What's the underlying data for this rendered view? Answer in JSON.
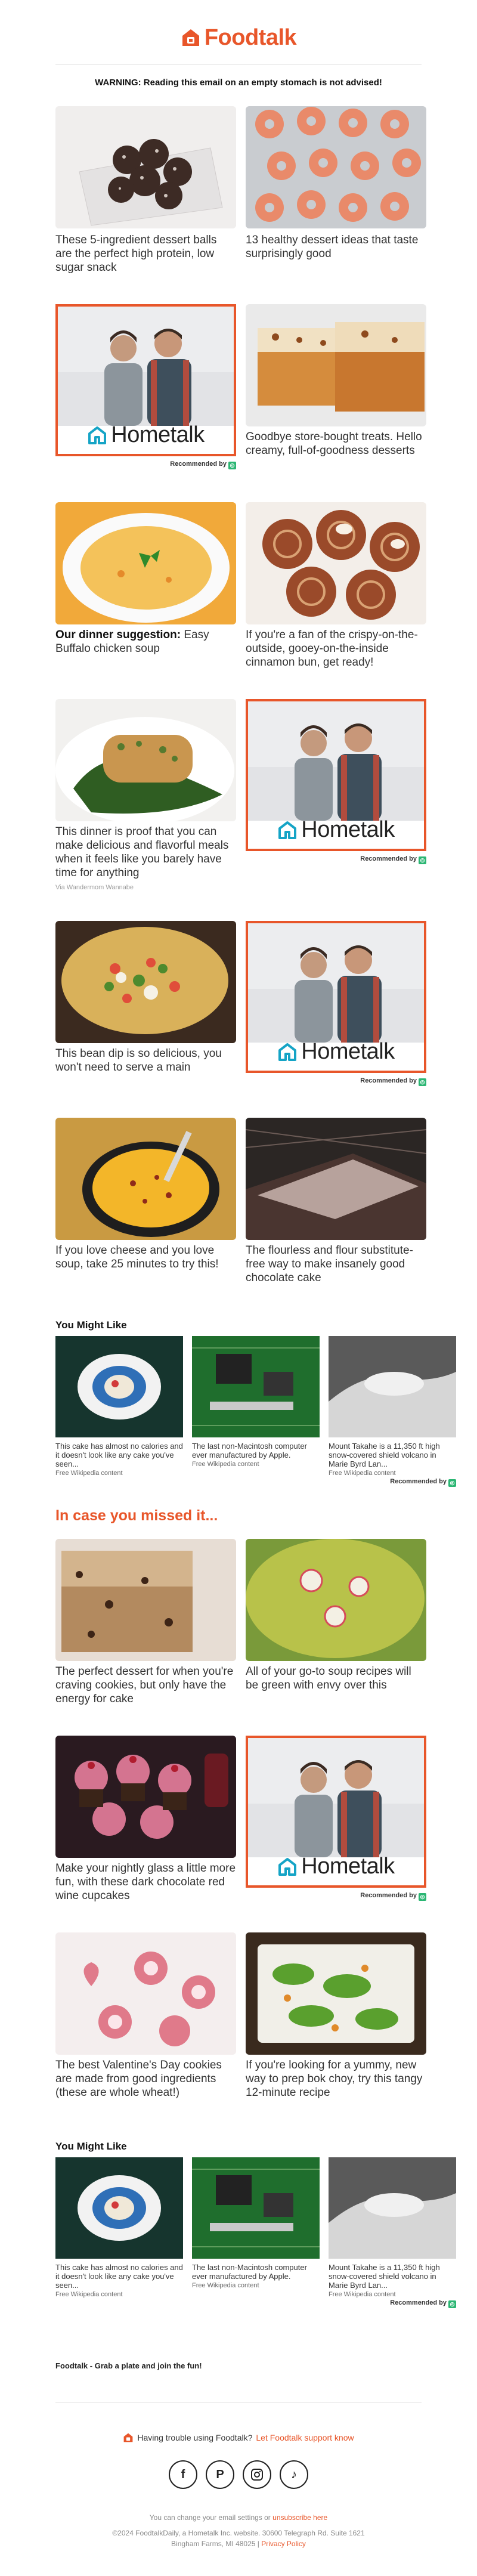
{
  "header": {
    "logo_text": "Foodtalk"
  },
  "warning": "WARNING: Reading this email on an empty stomach is not advised!",
  "articles": [
    {
      "caption": "These 5-ingredient dessert balls are the perfect high protein, low sugar snack"
    },
    {
      "caption": "13 healthy dessert ideas that taste surprisingly good"
    },
    {
      "caption": "Goodbye store-bought treats. Hello creamy, full-of-goodness desserts"
    },
    {
      "lead": "Our dinner suggestion:",
      "caption": "Easy Buffalo chicken soup"
    },
    {
      "caption": "If you're a fan of the crispy-on-the-outside, gooey-on-the-inside cinnamon bun, get ready!"
    },
    {
      "caption": "This dinner is proof that you can make delicious and flavorful meals when it feels like you barely have time for anything",
      "source": "Via Wandermom Wannabe"
    },
    {
      "caption": "This bean dip is so delicious, you won't need to serve a main"
    },
    {
      "caption": "If you love cheese and you love soup, take 25 minutes to try this!"
    },
    {
      "caption": "The flourless and flour substitute-free way to make insanely good chocolate cake"
    },
    {
      "caption": "The perfect dessert for when you're craving cookies, but only have the energy for cake"
    },
    {
      "caption": "All of your go-to soup recipes will be green with envy over this"
    },
    {
      "caption": "Make your nightly glass a little more fun, with these dark chocolate red wine cupcakes"
    },
    {
      "caption": "The best Valentine's Day cookies are made from good ingredients (these are whole wheat!)"
    },
    {
      "caption": "If you're looking for a yummy, new way to prep bok choy, try this tangy 12-minute recipe"
    }
  ],
  "ad": {
    "brand": "Hometalk",
    "recommended": "Recommended by"
  },
  "you_might_like": {
    "title": "You Might Like",
    "items": [
      {
        "caption": "This cake has almost no calories and it doesn't look like any cake you've seen...",
        "source": "Free Wikipedia content"
      },
      {
        "caption": "The last non-Macintosh computer ever manufactured by Apple.",
        "source": "Free Wikipedia content"
      },
      {
        "caption": "Mount Takahe is a 11,350 ft high snow-covered shield volcano in Marie Byrd Lan...",
        "source": "Free Wikipedia content"
      }
    ]
  },
  "missed_title": "In case you missed it...",
  "footer": {
    "tagline": "Foodtalk - Grab a plate and join the fun!",
    "trouble_text": "Having trouble using Foodtalk?",
    "trouble_link": "Let Foodtalk support know",
    "settings_text": "You can change your email settings or",
    "unsubscribe": "unsubscribe here",
    "address": "©2024 FoodtalkDaily, a Hometalk Inc. website. 30600 Telegraph Rd. Suite 1621",
    "address2": "Bingham Farms, MI 48025",
    "privacy": "Privacy Policy",
    "social": [
      "facebook-icon",
      "pinterest-icon",
      "instagram-icon",
      "tiktok-icon"
    ]
  },
  "colors": {
    "accent": "#e8562a",
    "outbrain_green": "#2bb673"
  }
}
